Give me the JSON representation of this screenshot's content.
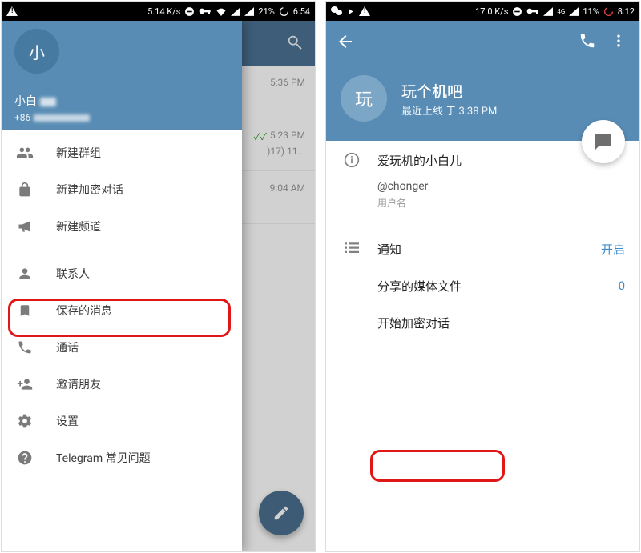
{
  "left": {
    "statusbar": {
      "speed": "5.14 K/s",
      "battery": "21%",
      "time": "6:54"
    },
    "drawer": {
      "avatar_letter": "小",
      "username": "小白",
      "phone_prefix": "+86",
      "menu": {
        "new_group": "新建群组",
        "new_secret_chat": "新建加密对话",
        "new_channel": "新建频道",
        "contacts": "联系人",
        "saved_messages": "保存的消息",
        "calls": "通话",
        "invite_friends": "邀请朋友",
        "settings": "设置",
        "faq": "Telegram 常见问题"
      }
    },
    "chatlist": {
      "r0_time": "5:36 PM",
      "r1_time": "5:23 PM",
      "r1_snip": ")17) 11...",
      "r2_time": "9:04 AM"
    }
  },
  "right": {
    "statusbar": {
      "speed": "17.0 K/s",
      "net": "4G",
      "battery": "11%",
      "time": "8:12"
    },
    "profile": {
      "avatar_letter": "玩",
      "title": "玩个机吧",
      "last_seen": "最近上线 于 3:38 PM",
      "info_name": "爱玩机的小白儿",
      "info_username": "@chonger",
      "info_username_label": "用户名"
    },
    "settings": {
      "notifications_label": "通知",
      "notifications_value": "开启",
      "shared_media_label": "分享的媒体文件",
      "shared_media_value": "0",
      "start_secret_chat": "开始加密对话"
    }
  }
}
